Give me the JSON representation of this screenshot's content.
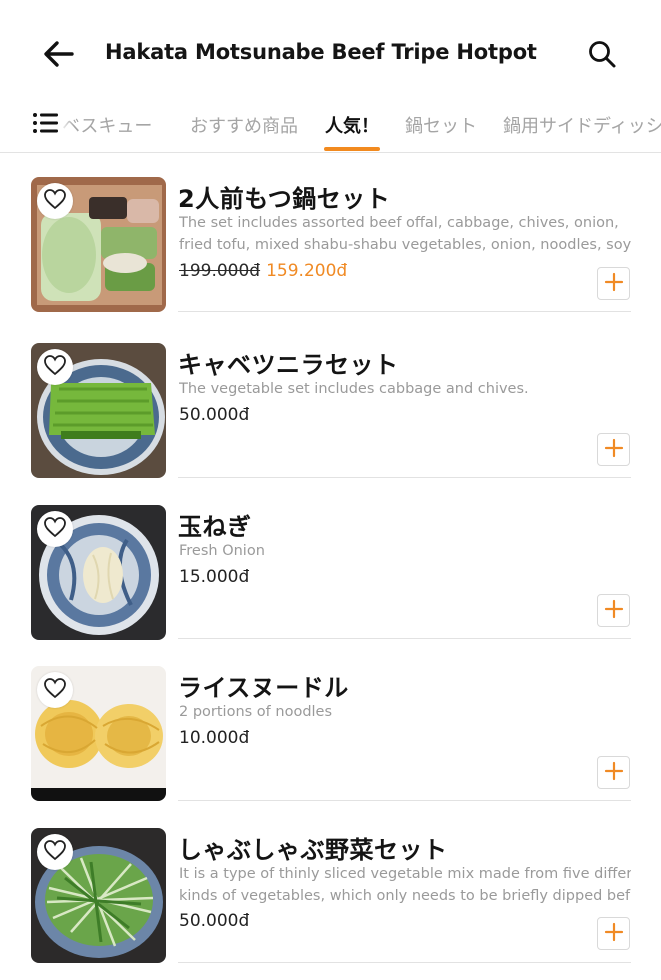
{
  "header": {
    "title": "Hakata Motsunabe Beef Tripe Hotpot",
    "back_icon": "arrow-left-icon",
    "search_icon": "search-icon"
  },
  "tabs": {
    "menu_icon": "list-menu-icon",
    "items": [
      {
        "label": "ベスキュー"
      },
      {
        "label": "おすすめ商品"
      },
      {
        "label": "人気！"
      },
      {
        "label": "鍋セット"
      },
      {
        "label": "鍋用サイドディッシュ"
      }
    ],
    "active_index": 2,
    "accent_color": "#f28a1f"
  },
  "products": [
    {
      "name": "2人前もつ鍋セット",
      "desc_line1": "The set includes assorted beef offal, cabbage, chives, onion,",
      "desc_line2": "fried tofu, mixed shabu-shabu vegetables, onion, noodles, soy…",
      "old_price": "199.000đ",
      "price": "159.200đ",
      "image": "hotpot-set-box-photo"
    },
    {
      "name": "キャベツニラセット",
      "desc_line1": "The vegetable set includes cabbage and chives.",
      "desc_line2": "",
      "old_price": "",
      "price": "50.000đ",
      "image": "chives-plate-photo"
    },
    {
      "name": "玉ねぎ",
      "desc_line1": "Fresh Onion",
      "desc_line2": "",
      "old_price": "",
      "price": "15.000đ",
      "image": "onion-plate-photo"
    },
    {
      "name": "ライスヌードル",
      "desc_line1": "2 portions of noodles",
      "desc_line2": "",
      "old_price": "",
      "price": "10.000đ",
      "image": "noodles-photo"
    },
    {
      "name": "しゃぶしゃぶ野菜セット",
      "desc_line1": "It is a type of thinly sliced vegetable mix made from five different",
      "desc_line2": "kinds of vegetables, which only needs to be briefly dipped bef…",
      "old_price": "",
      "price": "50.000đ",
      "image": "sprouts-plate-photo"
    }
  ],
  "colors": {
    "sale": "#f08a24",
    "add_plus": "#f08a24",
    "divider": "#e2e2e2"
  }
}
